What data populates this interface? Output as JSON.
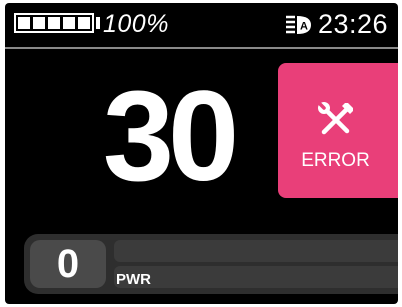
{
  "status": {
    "battery_percent": 100,
    "battery_text": "100%",
    "battery_cells": 5,
    "clock": "23:26",
    "light_icon": "headlight-auto-icon"
  },
  "speed": {
    "value": "30"
  },
  "error": {
    "label": "ERROR",
    "icon": "wrench-screwdriver-icon"
  },
  "power": {
    "value": "0",
    "label": "PWR",
    "level_fraction": 0
  },
  "colors": {
    "accent": "#e93f79",
    "background": "#000000",
    "bar_background": "#2e2e2e",
    "text": "#ffffff"
  }
}
